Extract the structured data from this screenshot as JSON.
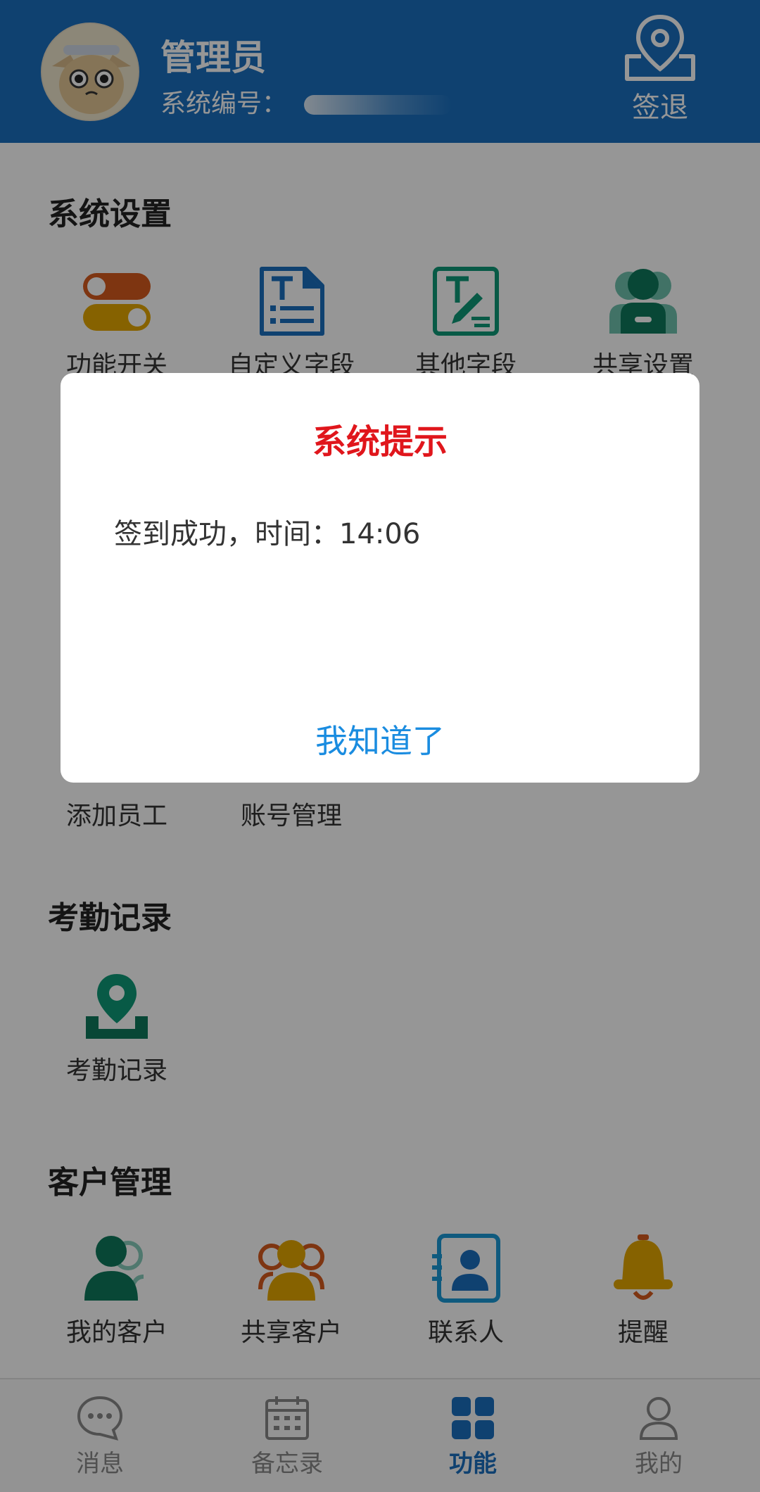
{
  "header": {
    "user_name": "管理员",
    "system_no_label": "系统编号：",
    "checkout_label": "签退",
    "colors": {
      "background": "#1a6fbf"
    }
  },
  "sections": {
    "system_settings": {
      "title": "系统设置",
      "items": [
        {
          "label": "功能开关",
          "icon": "toggle-switch-icon"
        },
        {
          "label": "自定义字段",
          "icon": "text-field-document-icon"
        },
        {
          "label": "其他字段",
          "icon": "text-edit-icon"
        },
        {
          "label": "共享设置",
          "icon": "shared-users-icon"
        }
      ]
    },
    "employee": {
      "items": [
        {
          "label": "添加员工"
        },
        {
          "label": "账号管理"
        }
      ]
    },
    "attendance": {
      "title": "考勤记录",
      "items": [
        {
          "label": "考勤记录",
          "icon": "location-pin-icon"
        }
      ]
    },
    "customers": {
      "title": "客户管理",
      "items": [
        {
          "label": "我的客户",
          "icon": "my-customers-icon"
        },
        {
          "label": "共享客户",
          "icon": "shared-customers-icon"
        },
        {
          "label": "联系人",
          "icon": "contact-card-icon"
        },
        {
          "label": "提醒",
          "icon": "bell-icon"
        }
      ]
    }
  },
  "bottom_nav": {
    "items": [
      {
        "label": "消息",
        "icon": "chat-bubble-icon"
      },
      {
        "label": "备忘录",
        "icon": "calendar-icon"
      },
      {
        "label": "功能",
        "icon": "grid-icon"
      },
      {
        "label": "我的",
        "icon": "person-icon"
      }
    ],
    "active_index": 2
  },
  "dialog": {
    "title": "系统提示",
    "message": "签到成功，时间：14:06",
    "confirm_label": "我知道了",
    "colors": {
      "title": "#e0161c",
      "button": "#1a8ce0"
    }
  }
}
